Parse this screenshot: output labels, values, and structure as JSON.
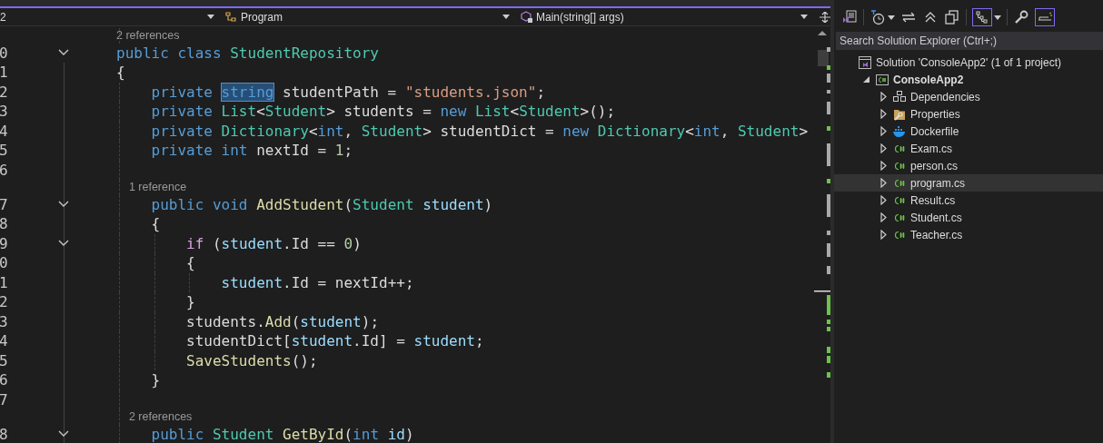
{
  "editor": {
    "nav": [
      {
        "label": "2",
        "kind": "project"
      },
      {
        "label": "Program",
        "kind": "class"
      },
      {
        "label": "Main(string[] args)",
        "kind": "method"
      }
    ],
    "lines": [
      {
        "kind": "codelens",
        "text": "2 references"
      },
      {
        "kind": "code",
        "number": "0",
        "fold": true,
        "tokens": [
          {
            "text": "public class ",
            "kind": "keyword"
          },
          {
            "text": "StudentRepository",
            "kind": "type"
          }
        ]
      },
      {
        "kind": "code",
        "number": "1",
        "fold": false,
        "tokens": [
          {
            "text": "{",
            "kind": "plain"
          }
        ]
      },
      {
        "kind": "code",
        "number": "2",
        "fold": false,
        "tokens": [
          {
            "text": "    private ",
            "kind": "keyword"
          },
          {
            "text": "string",
            "kind": "keyword",
            "highlighted": true
          },
          {
            "text": " studentPath = ",
            "kind": "plain"
          },
          {
            "text": "\"students.json\"",
            "kind": "string"
          },
          {
            "text": ";",
            "kind": "plain"
          }
        ]
      },
      {
        "kind": "code",
        "number": "3",
        "fold": false,
        "tokens": [
          {
            "text": "    private ",
            "kind": "keyword"
          },
          {
            "text": "List",
            "kind": "type"
          },
          {
            "text": "<",
            "kind": "plain"
          },
          {
            "text": "Student",
            "kind": "type"
          },
          {
            "text": "> students = ",
            "kind": "plain"
          },
          {
            "text": "new ",
            "kind": "keyword"
          },
          {
            "text": "List",
            "kind": "type"
          },
          {
            "text": "<",
            "kind": "plain"
          },
          {
            "text": "Student",
            "kind": "type"
          },
          {
            "text": ">();",
            "kind": "plain"
          }
        ]
      },
      {
        "kind": "code",
        "number": "4",
        "fold": false,
        "tokens": [
          {
            "text": "    private ",
            "kind": "keyword"
          },
          {
            "text": "Dictionary",
            "kind": "type"
          },
          {
            "text": "<",
            "kind": "plain"
          },
          {
            "text": "int",
            "kind": "keyword"
          },
          {
            "text": ", ",
            "kind": "plain"
          },
          {
            "text": "Student",
            "kind": "type"
          },
          {
            "text": "> studentDict = ",
            "kind": "plain"
          },
          {
            "text": "new ",
            "kind": "keyword"
          },
          {
            "text": "Dictionary",
            "kind": "type"
          },
          {
            "text": "<",
            "kind": "plain"
          },
          {
            "text": "int",
            "kind": "keyword"
          },
          {
            "text": ", ",
            "kind": "plain"
          },
          {
            "text": "Student",
            "kind": "type"
          },
          {
            "text": ">",
            "kind": "plain"
          }
        ]
      },
      {
        "kind": "code",
        "number": "5",
        "fold": false,
        "tokens": [
          {
            "text": "    private int ",
            "kind": "keyword"
          },
          {
            "text": "nextId = ",
            "kind": "plain"
          },
          {
            "text": "1",
            "kind": "number"
          },
          {
            "text": ";",
            "kind": "plain"
          }
        ]
      },
      {
        "kind": "code",
        "number": "6",
        "fold": false
      },
      {
        "kind": "codelens",
        "text": "    1 reference"
      },
      {
        "kind": "code",
        "number": "7",
        "fold": true,
        "tokens": [
          {
            "text": "    public void ",
            "kind": "keyword"
          },
          {
            "text": "AddStudent",
            "kind": "method"
          },
          {
            "text": "(",
            "kind": "plain"
          },
          {
            "text": "Student ",
            "kind": "type"
          },
          {
            "text": "student",
            "kind": "variable"
          },
          {
            "text": ")",
            "kind": "plain"
          }
        ]
      },
      {
        "kind": "code",
        "number": "8",
        "fold": false,
        "tokens": [
          {
            "text": "    {",
            "kind": "plain"
          }
        ]
      },
      {
        "kind": "code",
        "number": "9",
        "fold": true,
        "tokens": [
          {
            "text": "        if ",
            "kind": "control"
          },
          {
            "text": "(",
            "kind": "plain"
          },
          {
            "text": "student",
            "kind": "variable"
          },
          {
            "text": ".Id == ",
            "kind": "plain"
          },
          {
            "text": "0",
            "kind": "number"
          },
          {
            "text": ")",
            "kind": "plain"
          }
        ]
      },
      {
        "kind": "code",
        "number": "0",
        "fold": false,
        "tokens": [
          {
            "text": "        {",
            "kind": "plain"
          }
        ]
      },
      {
        "kind": "code",
        "number": "1",
        "fold": false,
        "tokens": [
          {
            "text": "            student",
            "kind": "variable"
          },
          {
            "text": ".Id = nextId++;",
            "kind": "plain"
          }
        ]
      },
      {
        "kind": "code",
        "number": "2",
        "fold": false,
        "tokens": [
          {
            "text": "        }",
            "kind": "plain"
          }
        ]
      },
      {
        "kind": "code",
        "number": "3",
        "fold": false,
        "tokens": [
          {
            "text": "        students.",
            "kind": "plain"
          },
          {
            "text": "Add",
            "kind": "method"
          },
          {
            "text": "(",
            "kind": "plain"
          },
          {
            "text": "student",
            "kind": "variable"
          },
          {
            "text": ");",
            "kind": "plain"
          }
        ]
      },
      {
        "kind": "code",
        "number": "4",
        "fold": false,
        "tokens": [
          {
            "text": "        studentDict[",
            "kind": "plain"
          },
          {
            "text": "student",
            "kind": "variable"
          },
          {
            "text": ".Id] = ",
            "kind": "plain"
          },
          {
            "text": "student",
            "kind": "variable"
          },
          {
            "text": ";",
            "kind": "plain"
          }
        ]
      },
      {
        "kind": "code",
        "number": "5",
        "fold": false,
        "tokens": [
          {
            "text": "        SaveStudents",
            "kind": "method"
          },
          {
            "text": "();",
            "kind": "plain"
          }
        ]
      },
      {
        "kind": "code",
        "number": "6",
        "fold": false,
        "tokens": [
          {
            "text": "    }",
            "kind": "plain"
          }
        ]
      },
      {
        "kind": "code",
        "number": "7",
        "fold": false
      },
      {
        "kind": "codelens",
        "text": "    2 references"
      },
      {
        "kind": "code",
        "number": "8",
        "fold": true,
        "tokens": [
          {
            "text": "    public ",
            "kind": "keyword"
          },
          {
            "text": "Student ",
            "kind": "type"
          },
          {
            "text": "GetById",
            "kind": "method"
          },
          {
            "text": "(",
            "kind": "plain"
          },
          {
            "text": "int ",
            "kind": "keyword"
          },
          {
            "text": "id",
            "kind": "variable"
          },
          {
            "text": ")",
            "kind": "plain"
          }
        ]
      }
    ]
  },
  "solution_explorer": {
    "search": {
      "placeholder": "Search Solution Explorer (Ctrl+;)"
    },
    "tree": [
      {
        "label": "Solution 'ConsoleApp2' (1 of 1 project)",
        "kind": "solution",
        "selected": false,
        "children": [
          {
            "label": "ConsoleApp2",
            "kind": "project",
            "expanded": true,
            "selected": false,
            "children": [
              {
                "label": "Dependencies",
                "kind": "dependencies",
                "expanded": false,
                "selected": false
              },
              {
                "label": "Properties",
                "kind": "properties",
                "expanded": false,
                "selected": false
              },
              {
                "label": "Dockerfile",
                "kind": "docker",
                "expanded": false,
                "selected": false
              },
              {
                "label": "Exam.cs",
                "kind": "csharp",
                "expanded": false,
                "selected": false
              },
              {
                "label": "person.cs",
                "kind": "csharp",
                "expanded": false,
                "selected": false
              },
              {
                "label": "program.cs",
                "kind": "csharp",
                "expanded": false,
                "selected": true
              },
              {
                "label": "Result.cs",
                "kind": "csharp",
                "expanded": false,
                "selected": false
              },
              {
                "label": "Student.cs",
                "kind": "csharp",
                "expanded": false,
                "selected": false
              },
              {
                "label": "Teacher.cs",
                "kind": "csharp",
                "expanded": false,
                "selected": false
              }
            ]
          }
        ]
      }
    ]
  }
}
